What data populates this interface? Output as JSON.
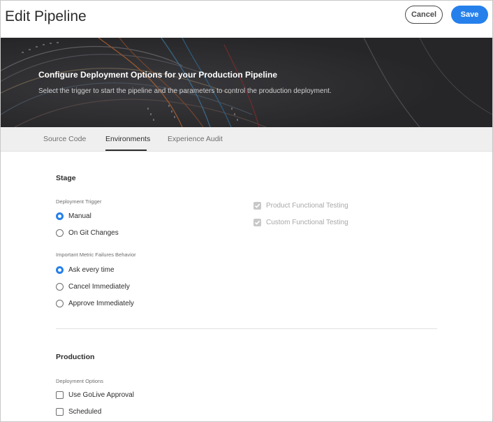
{
  "header": {
    "title": "Edit Pipeline",
    "cancel_label": "Cancel",
    "save_label": "Save"
  },
  "banner": {
    "title": "Configure Deployment Options for your Production Pipeline",
    "subtitle": "Select the trigger to start the pipeline and the parameters to control the production deployment."
  },
  "tabs": [
    {
      "label": "Source Code",
      "active": false
    },
    {
      "label": "Environments",
      "active": true
    },
    {
      "label": "Experience Audit",
      "active": false
    }
  ],
  "stage": {
    "title": "Stage",
    "deployment_trigger": {
      "label": "Deployment Trigger",
      "options": [
        "Manual",
        "On Git Changes"
      ],
      "selected": "Manual"
    },
    "metric_failures": {
      "label": "Important Metric Failures Behavior",
      "options": [
        "Ask every time",
        "Cancel Immediately",
        "Approve Immediately"
      ],
      "selected": "Ask every time"
    },
    "testing": [
      {
        "label": "Product Functional Testing",
        "checked": true,
        "disabled": true
      },
      {
        "label": "Custom Functional Testing",
        "checked": true,
        "disabled": true
      }
    ]
  },
  "production": {
    "title": "Production",
    "deployment_options": {
      "label": "Deployment Options",
      "options": [
        {
          "label": "Use GoLive Approval",
          "checked": false
        },
        {
          "label": "Scheduled",
          "checked": false
        }
      ]
    }
  },
  "colors": {
    "accent": "#2680eb",
    "banner_bg": "#262628",
    "tab_bg": "#efefef"
  }
}
